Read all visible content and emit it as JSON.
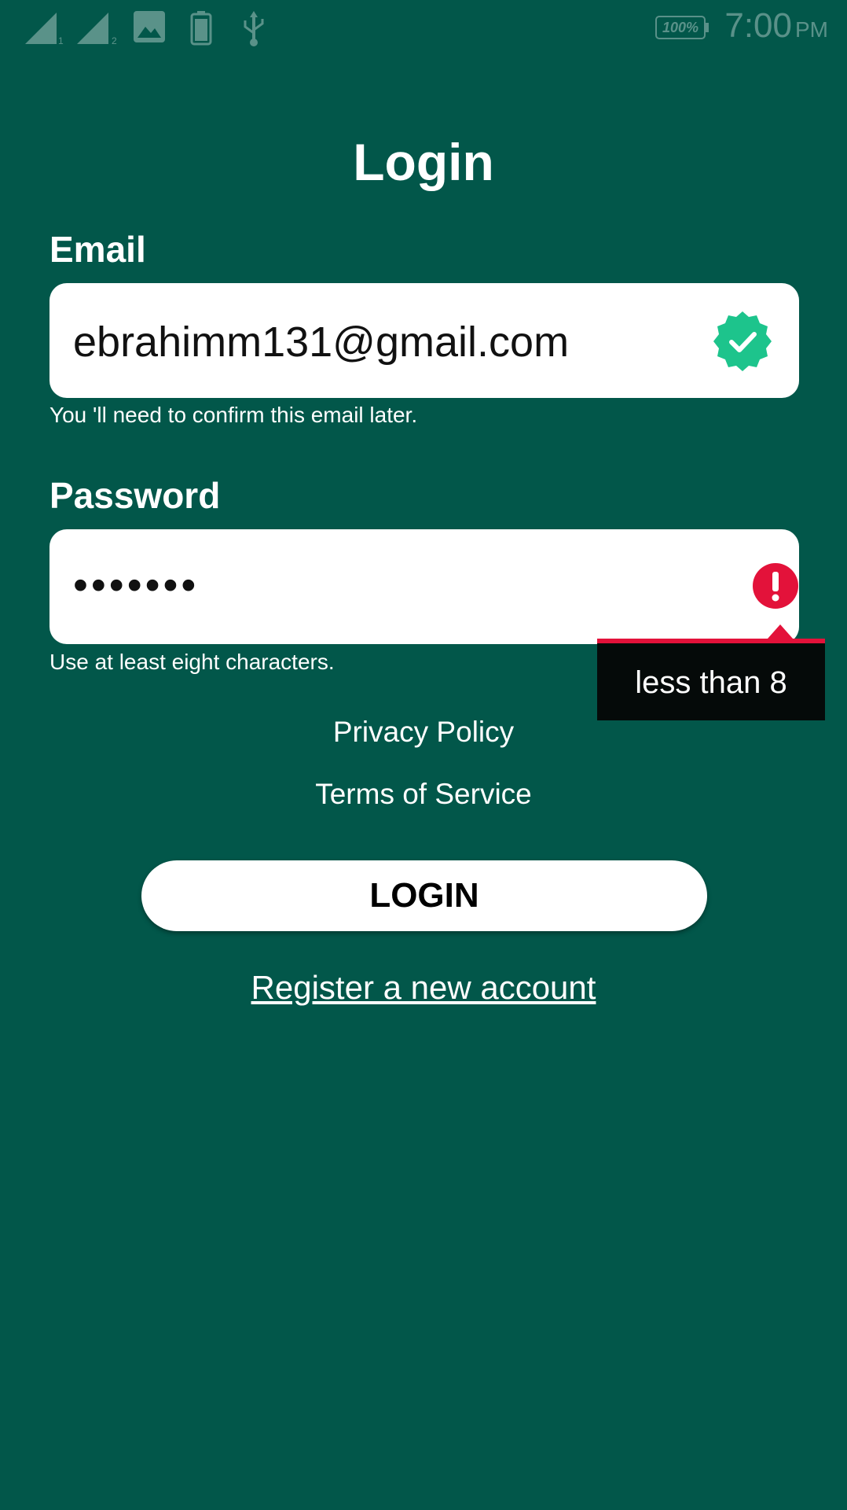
{
  "status_bar": {
    "time": "7:00",
    "ampm": "PM",
    "battery": "100%",
    "icons": [
      "signal-1-icon",
      "signal-2-icon",
      "image-icon",
      "battery-saver-icon",
      "usb-icon"
    ]
  },
  "title": "Login",
  "email": {
    "label": "Email",
    "value": "ebrahimm131@gmail.com",
    "hint": "You 'll need to confirm this email later.",
    "status_icon": "verified-check-icon"
  },
  "password": {
    "label": "Password",
    "value": "•••••••",
    "hint": "Use at least eight characters.",
    "status_icon": "error-icon",
    "error_tooltip": "less than 8"
  },
  "links": {
    "privacy": "Privacy Policy",
    "terms": "Terms of Service"
  },
  "login_button": "LOGIN",
  "register_link": "Register a new account",
  "colors": {
    "background": "#02574a",
    "verified": "#1dc48c",
    "error": "#e3123a"
  }
}
